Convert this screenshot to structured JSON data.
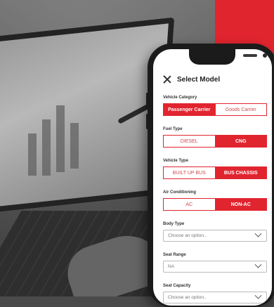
{
  "screen": {
    "title": "Select Model",
    "close_icon": "close-icon"
  },
  "vehicle_category": {
    "label": "Vehicle Category",
    "options": [
      "Passenger Carrier",
      "Goods Carrier"
    ],
    "selected": "Passenger Carrier"
  },
  "fuel_type": {
    "label": "Fuel Type",
    "options": [
      "DIESEL",
      "CNG"
    ],
    "selected": "CNG"
  },
  "vehicle_type": {
    "label": "Vehicle Type",
    "options": [
      "BUILT UP BUS",
      "BUS CHASSIS"
    ],
    "selected": "BUS CHASSIS"
  },
  "air_conditioning": {
    "label": "Air Conditioning",
    "options": [
      "AC",
      "NON-AC"
    ],
    "selected": "NON-AC"
  },
  "body_type": {
    "label": "Body Type",
    "value": "Choose an option.."
  },
  "seat_range": {
    "label": "Seat Range",
    "value": "NA"
  },
  "seat_capacity": {
    "label": "Seat Capacity",
    "value": "Choose an option.."
  },
  "colors": {
    "accent": "#e1252f"
  }
}
